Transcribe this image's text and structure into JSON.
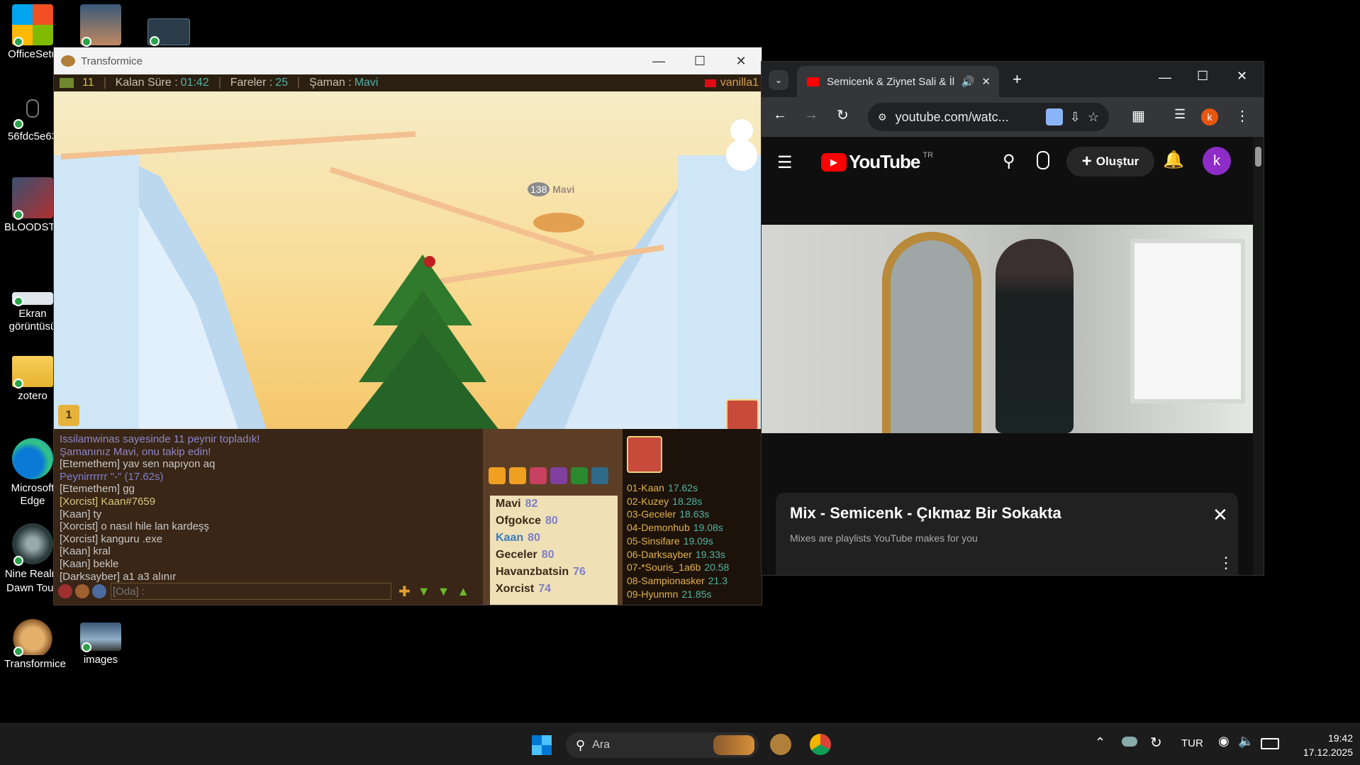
{
  "desktop": {
    "icons": [
      {
        "label": "OfficeSetu"
      },
      {
        "label": ""
      },
      {
        "label": ""
      },
      {
        "label": "56fdc5e63"
      },
      {
        "label": "BLOODSTR"
      },
      {
        "label": "Ekran görüntüsü"
      },
      {
        "label": "zotero"
      },
      {
        "label": "Microsoft Edge"
      },
      {
        "label": "Nine Realm Dawn Touc"
      },
      {
        "label": "Transformice"
      },
      {
        "label": "images"
      }
    ]
  },
  "game_window": {
    "title": "Transformice",
    "hud": {
      "cheese_count": "11",
      "time_label": "Kalan Süre :",
      "time_value": "01:42",
      "mice_label": "Fareler :",
      "mice_value": "25",
      "shaman_label": "Şaman :",
      "shaman_value": "Mavi",
      "room": "vanilla1"
    },
    "map_badge": "1",
    "chat": [
      {
        "text": "Issilamwinas sayesinde 11 peynir topladık!",
        "color": "#8f86c9"
      },
      {
        "text": "Şamanınız Mavi, onu takip edin!",
        "color": "#8f86c9"
      },
      {
        "text": "[Etemethem] yav sen napıyon aq",
        "color": "#c8c8c8"
      },
      {
        "text": "Peynirrrrrr \"-\" (17.62s)",
        "color": "#7d7fd0"
      },
      {
        "text": "[Etemethem] gg",
        "color": "#c8c8c8"
      },
      {
        "text": "[Xorcist] Kaan#7659",
        "color": "#d7c77e"
      },
      {
        "text": "[Kaan] ty",
        "color": "#c8c8c8"
      },
      {
        "text": "[Xorcist] o nasıl hile lan kardeşş",
        "color": "#c8c8c8"
      },
      {
        "text": "[Xorcist] kanguru .exe",
        "color": "#c8c8c8"
      },
      {
        "text": "[Kaan] kral",
        "color": "#c8c8c8"
      },
      {
        "text": "[Kaan] bekle",
        "color": "#c8c8c8"
      },
      {
        "text": "[Darksayber] a1 a3 alınır",
        "color": "#c8c8c8"
      }
    ],
    "chat_input_placeholder": "[Oda] :",
    "players": [
      {
        "name": "Mavi",
        "score": "82",
        "color": "#3a2a18"
      },
      {
        "name": "Ofgokce",
        "score": "80",
        "color": "#3a2a18"
      },
      {
        "name": "Kaan",
        "score": "80",
        "color": "#3a7cc0"
      },
      {
        "name": "Geceler",
        "score": "80",
        "color": "#3a2a18"
      },
      {
        "name": "Havanzbatsin",
        "score": "76",
        "color": "#3a2a18"
      },
      {
        "name": "Xorcist",
        "score": "74",
        "color": "#3a2a18"
      }
    ],
    "times": [
      {
        "rank": "01-Kaan",
        "time": "17.62s"
      },
      {
        "rank": "02-Kuzey",
        "time": "18.28s"
      },
      {
        "rank": "03-Geceler",
        "time": "18.63s"
      },
      {
        "rank": "04-Demonhub",
        "time": "19.08s"
      },
      {
        "rank": "05-Sinsifare",
        "time": "19.09s"
      },
      {
        "rank": "06-Darksayber",
        "time": "19.33s"
      },
      {
        "rank": "07-*Souris_1a6b",
        "time": "20.58"
      },
      {
        "rank": "08-Sampionasker",
        "time": "21.3"
      },
      {
        "rank": "09-Hyunmn",
        "time": "21.85s"
      }
    ],
    "shaman_tag": {
      "level": "138",
      "name": "Mavi"
    }
  },
  "browser": {
    "tab_title": "Semicenk & Ziynet Sali & İli",
    "url": "youtube.com/watc...",
    "profile_initial": "k",
    "youtube": {
      "logo_text": "YouTube",
      "region": "TR",
      "create_label": "Oluştur",
      "avatar_initial": "k"
    },
    "mix": {
      "title": "Mix - Semicenk - Çıkmaz Bir Sokakta",
      "subtitle": "Mixes are playlists YouTube makes for you"
    }
  },
  "taskbar": {
    "search_placeholder": "Ara",
    "language": "TUR",
    "time": "19:42",
    "date": "17.12.2025"
  },
  "colors": {
    "accent_teal": "#4fb4a6",
    "youtube_red": "#ff0000",
    "chrome_profile": "#e8560f",
    "yt_avatar": "#8e2cc7"
  }
}
